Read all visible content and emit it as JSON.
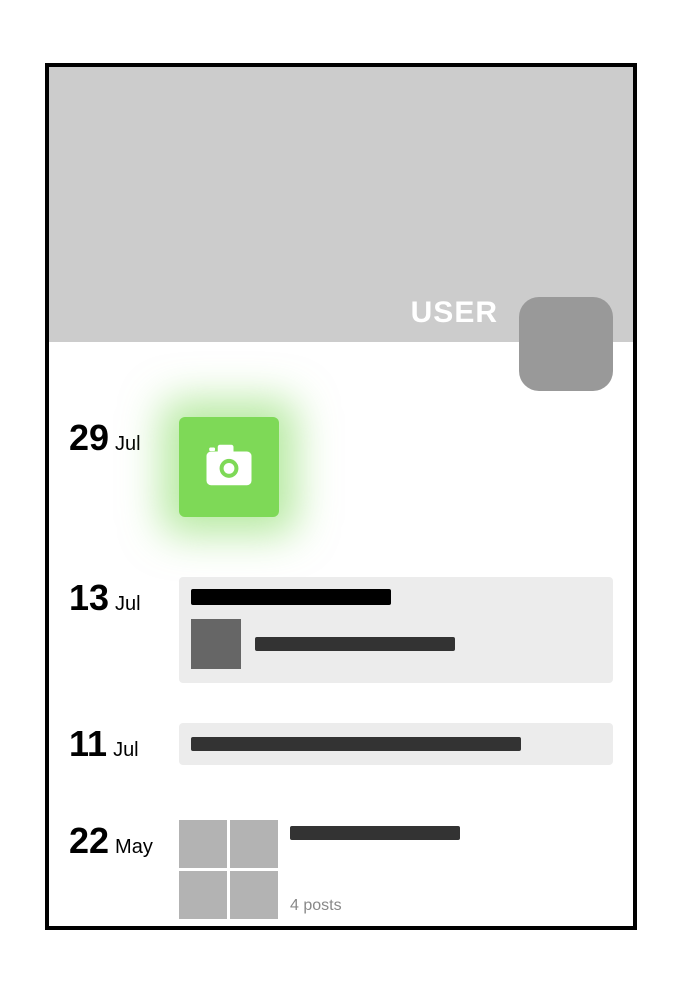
{
  "header": {
    "username": "USER"
  },
  "timeline": [
    {
      "day": "29",
      "month": "Jul"
    },
    {
      "day": "13",
      "month": "Jul"
    },
    {
      "day": "11",
      "month": "Jul"
    },
    {
      "day": "22",
      "month": "May",
      "posts_label": "4 posts"
    }
  ],
  "icons": {
    "camera": "camera-icon"
  }
}
